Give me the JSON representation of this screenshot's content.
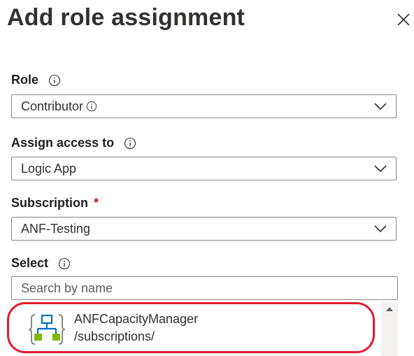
{
  "panel": {
    "title": "Add role assignment",
    "close_icon": "close-icon"
  },
  "role": {
    "label": "Role",
    "value": "Contributor"
  },
  "assign_access": {
    "label": "Assign access to",
    "value": "Logic App"
  },
  "subscription": {
    "label": "Subscription",
    "required_mark": "*",
    "value": "ANF-Testing"
  },
  "select": {
    "label": "Select",
    "placeholder": "Search by name"
  },
  "results": [
    {
      "name": "ANFCapacityManager",
      "path": "/subscriptions/",
      "icon": "logic-app-icon"
    }
  ],
  "colors": {
    "highlight": "#e21b2c",
    "required": "#c50f1f",
    "icon_blue": "#0072c6",
    "icon_green": "#7fba00"
  }
}
